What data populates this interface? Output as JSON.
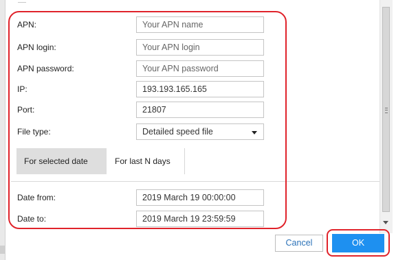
{
  "form": {
    "apn": {
      "label": "APN:",
      "placeholder": "Your APN name",
      "value": ""
    },
    "apn_login": {
      "label": "APN login:",
      "placeholder": "Your APN login",
      "value": ""
    },
    "apn_password": {
      "label": "APN password:",
      "placeholder": "Your APN password",
      "value": ""
    },
    "ip": {
      "label": "IP:",
      "value": "193.193.165.165"
    },
    "port": {
      "label": "Port:",
      "value": "21807"
    },
    "file_type": {
      "label": "File type:",
      "selected": "Detailed speed file"
    }
  },
  "tabs": [
    {
      "label": "For selected date",
      "active": true
    },
    {
      "label": "For last N days",
      "active": false
    }
  ],
  "dates": {
    "from": {
      "label": "Date from:",
      "value": "2019 March 19 00:00:00"
    },
    "to": {
      "label": "Date to:",
      "value": "2019 March 19 23:59:59"
    }
  },
  "buttons": {
    "cancel": "Cancel",
    "ok": "OK"
  },
  "colors": {
    "ok_button": "#1e90f0",
    "cancel_text": "#2b72b8",
    "annotation": "#e0222a"
  }
}
